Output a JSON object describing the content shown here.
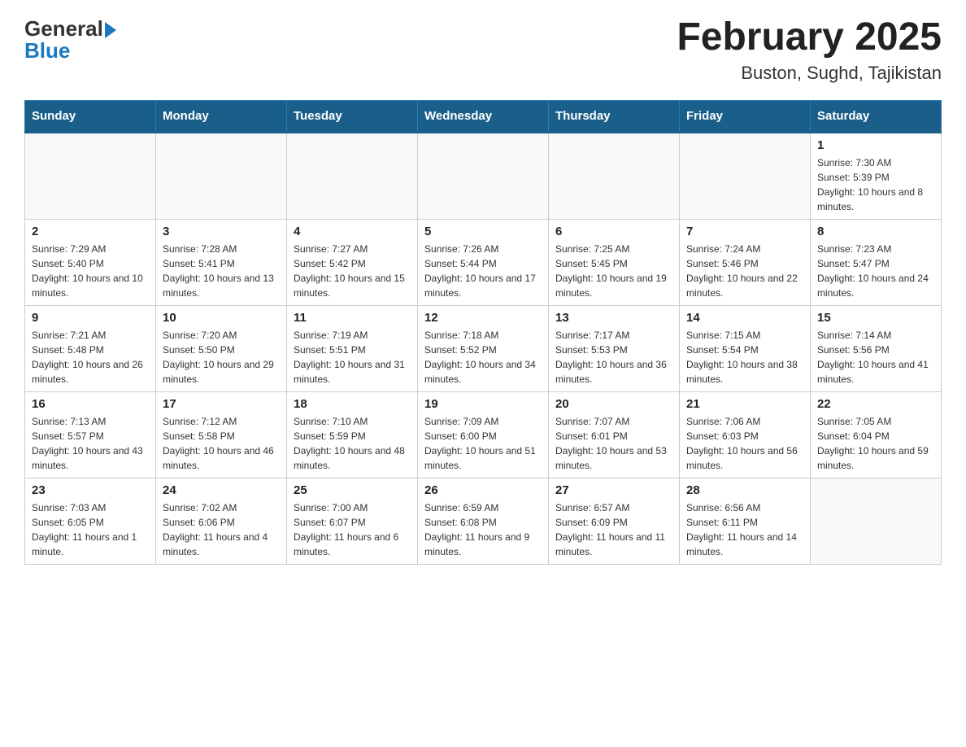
{
  "logo": {
    "text_general": "General",
    "text_blue": "Blue"
  },
  "title": "February 2025",
  "subtitle": "Buston, Sughd, Tajikistan",
  "days_of_week": [
    "Sunday",
    "Monday",
    "Tuesday",
    "Wednesday",
    "Thursday",
    "Friday",
    "Saturday"
  ],
  "weeks": [
    [
      {
        "day": "",
        "info": ""
      },
      {
        "day": "",
        "info": ""
      },
      {
        "day": "",
        "info": ""
      },
      {
        "day": "",
        "info": ""
      },
      {
        "day": "",
        "info": ""
      },
      {
        "day": "",
        "info": ""
      },
      {
        "day": "1",
        "info": "Sunrise: 7:30 AM\nSunset: 5:39 PM\nDaylight: 10 hours and 8 minutes."
      }
    ],
    [
      {
        "day": "2",
        "info": "Sunrise: 7:29 AM\nSunset: 5:40 PM\nDaylight: 10 hours and 10 minutes."
      },
      {
        "day": "3",
        "info": "Sunrise: 7:28 AM\nSunset: 5:41 PM\nDaylight: 10 hours and 13 minutes."
      },
      {
        "day": "4",
        "info": "Sunrise: 7:27 AM\nSunset: 5:42 PM\nDaylight: 10 hours and 15 minutes."
      },
      {
        "day": "5",
        "info": "Sunrise: 7:26 AM\nSunset: 5:44 PM\nDaylight: 10 hours and 17 minutes."
      },
      {
        "day": "6",
        "info": "Sunrise: 7:25 AM\nSunset: 5:45 PM\nDaylight: 10 hours and 19 minutes."
      },
      {
        "day": "7",
        "info": "Sunrise: 7:24 AM\nSunset: 5:46 PM\nDaylight: 10 hours and 22 minutes."
      },
      {
        "day": "8",
        "info": "Sunrise: 7:23 AM\nSunset: 5:47 PM\nDaylight: 10 hours and 24 minutes."
      }
    ],
    [
      {
        "day": "9",
        "info": "Sunrise: 7:21 AM\nSunset: 5:48 PM\nDaylight: 10 hours and 26 minutes."
      },
      {
        "day": "10",
        "info": "Sunrise: 7:20 AM\nSunset: 5:50 PM\nDaylight: 10 hours and 29 minutes."
      },
      {
        "day": "11",
        "info": "Sunrise: 7:19 AM\nSunset: 5:51 PM\nDaylight: 10 hours and 31 minutes."
      },
      {
        "day": "12",
        "info": "Sunrise: 7:18 AM\nSunset: 5:52 PM\nDaylight: 10 hours and 34 minutes."
      },
      {
        "day": "13",
        "info": "Sunrise: 7:17 AM\nSunset: 5:53 PM\nDaylight: 10 hours and 36 minutes."
      },
      {
        "day": "14",
        "info": "Sunrise: 7:15 AM\nSunset: 5:54 PM\nDaylight: 10 hours and 38 minutes."
      },
      {
        "day": "15",
        "info": "Sunrise: 7:14 AM\nSunset: 5:56 PM\nDaylight: 10 hours and 41 minutes."
      }
    ],
    [
      {
        "day": "16",
        "info": "Sunrise: 7:13 AM\nSunset: 5:57 PM\nDaylight: 10 hours and 43 minutes."
      },
      {
        "day": "17",
        "info": "Sunrise: 7:12 AM\nSunset: 5:58 PM\nDaylight: 10 hours and 46 minutes."
      },
      {
        "day": "18",
        "info": "Sunrise: 7:10 AM\nSunset: 5:59 PM\nDaylight: 10 hours and 48 minutes."
      },
      {
        "day": "19",
        "info": "Sunrise: 7:09 AM\nSunset: 6:00 PM\nDaylight: 10 hours and 51 minutes."
      },
      {
        "day": "20",
        "info": "Sunrise: 7:07 AM\nSunset: 6:01 PM\nDaylight: 10 hours and 53 minutes."
      },
      {
        "day": "21",
        "info": "Sunrise: 7:06 AM\nSunset: 6:03 PM\nDaylight: 10 hours and 56 minutes."
      },
      {
        "day": "22",
        "info": "Sunrise: 7:05 AM\nSunset: 6:04 PM\nDaylight: 10 hours and 59 minutes."
      }
    ],
    [
      {
        "day": "23",
        "info": "Sunrise: 7:03 AM\nSunset: 6:05 PM\nDaylight: 11 hours and 1 minute."
      },
      {
        "day": "24",
        "info": "Sunrise: 7:02 AM\nSunset: 6:06 PM\nDaylight: 11 hours and 4 minutes."
      },
      {
        "day": "25",
        "info": "Sunrise: 7:00 AM\nSunset: 6:07 PM\nDaylight: 11 hours and 6 minutes."
      },
      {
        "day": "26",
        "info": "Sunrise: 6:59 AM\nSunset: 6:08 PM\nDaylight: 11 hours and 9 minutes."
      },
      {
        "day": "27",
        "info": "Sunrise: 6:57 AM\nSunset: 6:09 PM\nDaylight: 11 hours and 11 minutes."
      },
      {
        "day": "28",
        "info": "Sunrise: 6:56 AM\nSunset: 6:11 PM\nDaylight: 11 hours and 14 minutes."
      },
      {
        "day": "",
        "info": ""
      }
    ]
  ]
}
